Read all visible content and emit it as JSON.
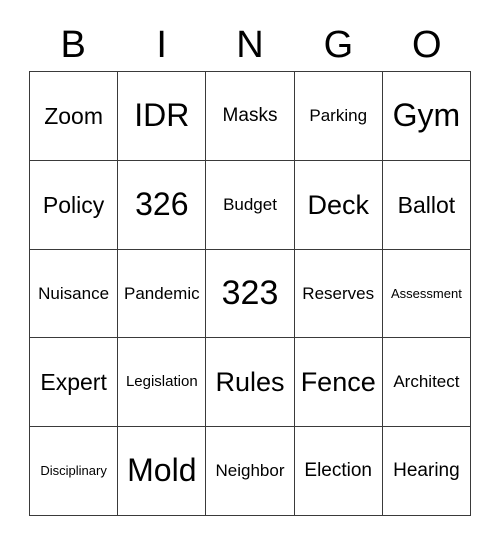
{
  "card": {
    "title": "BINGO",
    "header_letters": [
      "B",
      "I",
      "N",
      "G",
      "O"
    ],
    "rows": [
      [
        {
          "label": "Zoom",
          "size": "sz-l"
        },
        {
          "label": "IDR",
          "size": "sz-xxl"
        },
        {
          "label": "Masks",
          "size": "sz-ml"
        },
        {
          "label": "Parking",
          "size": "sz-m"
        },
        {
          "label": "Gym",
          "size": "sz-xxl"
        }
      ],
      [
        {
          "label": "Policy",
          "size": "sz-l"
        },
        {
          "label": "326",
          "size": "sz-xxl"
        },
        {
          "label": "Budget",
          "size": "sz-m"
        },
        {
          "label": "Deck",
          "size": "sz-xl"
        },
        {
          "label": "Ballot",
          "size": "sz-l"
        }
      ],
      [
        {
          "label": "Nuisance",
          "size": "sz-m"
        },
        {
          "label": "Pandemic",
          "size": "sz-m"
        },
        {
          "label": "323",
          "size": "sz-max"
        },
        {
          "label": "Reserves",
          "size": "sz-m"
        },
        {
          "label": "Assessment",
          "size": "sz-xs"
        }
      ],
      [
        {
          "label": "Expert",
          "size": "sz-l"
        },
        {
          "label": "Legislation",
          "size": "sz-s"
        },
        {
          "label": "Rules",
          "size": "sz-xl"
        },
        {
          "label": "Fence",
          "size": "sz-xl"
        },
        {
          "label": "Architect",
          "size": "sz-m"
        }
      ],
      [
        {
          "label": "Disciplinary",
          "size": "sz-xs"
        },
        {
          "label": "Mold",
          "size": "sz-xxl"
        },
        {
          "label": "Neighbor",
          "size": "sz-m"
        },
        {
          "label": "Election",
          "size": "sz-ml"
        },
        {
          "label": "Hearing",
          "size": "sz-ml"
        }
      ]
    ]
  },
  "colors": {
    "background": "#ffffff",
    "text": "#000000",
    "grid_line": "#3a3a3a"
  }
}
